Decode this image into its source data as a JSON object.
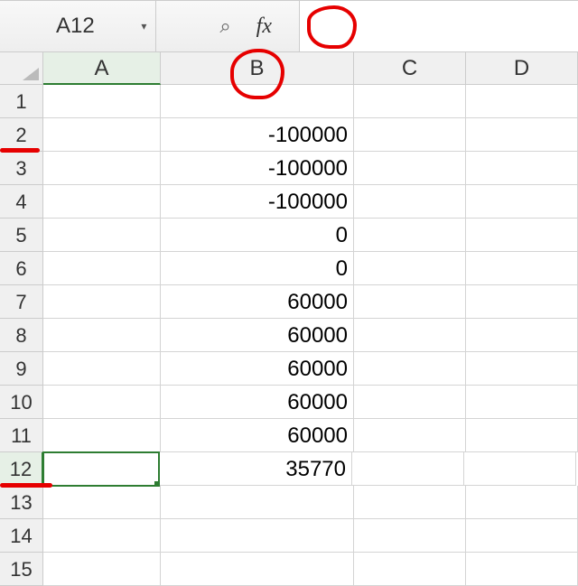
{
  "formula_bar": {
    "name_box_value": "A12",
    "dropdown_glyph": "▾",
    "search_glyph": "⌕",
    "fx_glyph": "fx",
    "formula_value": ""
  },
  "columns": [
    "A",
    "B",
    "C",
    "D"
  ],
  "active_column": "A",
  "active_row": 12,
  "selected_cell": "A12",
  "rows": [
    {
      "num": 1,
      "A": "",
      "B": "",
      "C": "",
      "D": ""
    },
    {
      "num": 2,
      "A": "",
      "B": "-100000",
      "C": "",
      "D": ""
    },
    {
      "num": 3,
      "A": "",
      "B": "-100000",
      "C": "",
      "D": ""
    },
    {
      "num": 4,
      "A": "",
      "B": "-100000",
      "C": "",
      "D": ""
    },
    {
      "num": 5,
      "A": "",
      "B": "0",
      "C": "",
      "D": ""
    },
    {
      "num": 6,
      "A": "",
      "B": "0",
      "C": "",
      "D": ""
    },
    {
      "num": 7,
      "A": "",
      "B": "60000",
      "C": "",
      "D": ""
    },
    {
      "num": 8,
      "A": "",
      "B": "60000",
      "C": "",
      "D": ""
    },
    {
      "num": 9,
      "A": "",
      "B": "60000",
      "C": "",
      "D": ""
    },
    {
      "num": 10,
      "A": "",
      "B": "60000",
      "C": "",
      "D": ""
    },
    {
      "num": 11,
      "A": "",
      "B": "60000",
      "C": "",
      "D": ""
    },
    {
      "num": 12,
      "A": "",
      "B": "35770",
      "C": "",
      "D": ""
    },
    {
      "num": 13,
      "A": "",
      "B": "",
      "C": "",
      "D": ""
    },
    {
      "num": 14,
      "A": "",
      "B": "",
      "C": "",
      "D": ""
    },
    {
      "num": 15,
      "A": "",
      "B": "",
      "C": "",
      "D": ""
    }
  ]
}
